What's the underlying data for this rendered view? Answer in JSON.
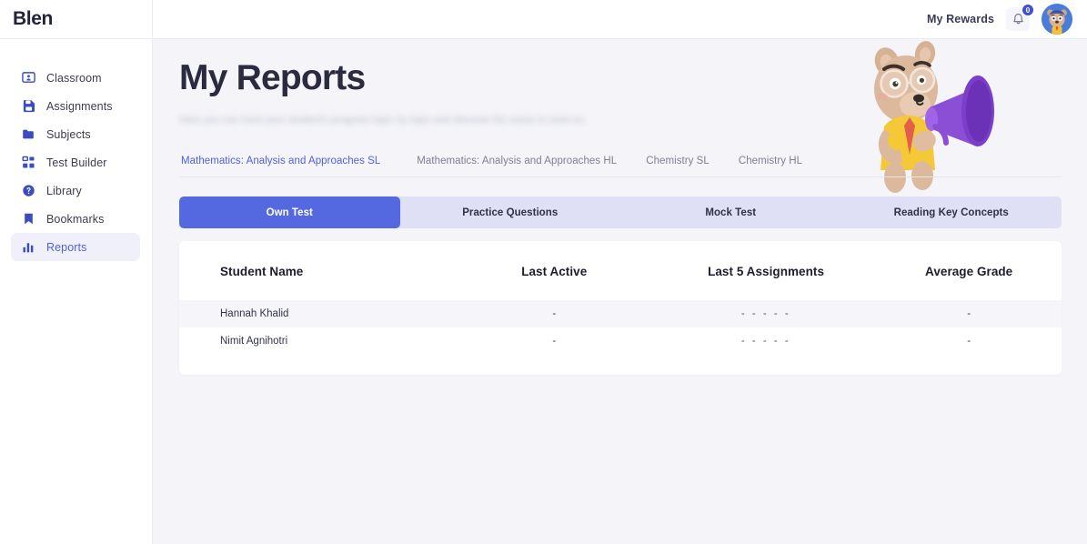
{
  "brand": {
    "logo": "Blen"
  },
  "topbar": {
    "rewards_label": "My Rewards",
    "notification_count": "0"
  },
  "sidebar": {
    "items": [
      {
        "label": "Classroom",
        "icon": "classroom-icon",
        "active": false
      },
      {
        "label": "Assignments",
        "icon": "assignments-icon",
        "active": false
      },
      {
        "label": "Subjects",
        "icon": "folder-icon",
        "active": false
      },
      {
        "label": "Test Builder",
        "icon": "grid-icon",
        "active": false
      },
      {
        "label": "Library",
        "icon": "help-circle-icon",
        "active": false
      },
      {
        "label": "Bookmarks",
        "icon": "bookmark-icon",
        "active": false
      },
      {
        "label": "Reports",
        "icon": "bar-chart-icon",
        "active": true
      }
    ]
  },
  "page": {
    "title": "My Reports",
    "subtitle": "Here you can track your student's progress topic by topic and discover the areas to work on."
  },
  "subject_tabs": [
    {
      "label": "Mathematics: Analysis and Approaches SL",
      "active": true
    },
    {
      "label": "Mathematics: Analysis and Approaches HL",
      "active": false
    },
    {
      "label": "Chemistry SL",
      "active": false
    },
    {
      "label": "Chemistry HL",
      "active": false
    }
  ],
  "segmented_tabs": [
    {
      "label": "Own Test",
      "active": true
    },
    {
      "label": "Practice Questions",
      "active": false
    },
    {
      "label": "Mock Test",
      "active": false
    },
    {
      "label": "Reading Key Concepts",
      "active": false
    }
  ],
  "table": {
    "headers": [
      "Student Name",
      "Last Active",
      "Last 5 Assignments",
      "Average Grade"
    ],
    "rows": [
      {
        "name": "Hannah Khalid",
        "last_active": "-",
        "last5": "- - - - -",
        "average": "-"
      },
      {
        "name": "Nimit Agnihotri",
        "last_active": "-",
        "last5": "- - - - -",
        "average": "-"
      }
    ]
  },
  "colors": {
    "accent": "#5468e0",
    "accent_text": "#4f63db",
    "page_bg": "#f4f4f9",
    "segment_bg": "#dfe0f5",
    "logo": "#232340"
  }
}
